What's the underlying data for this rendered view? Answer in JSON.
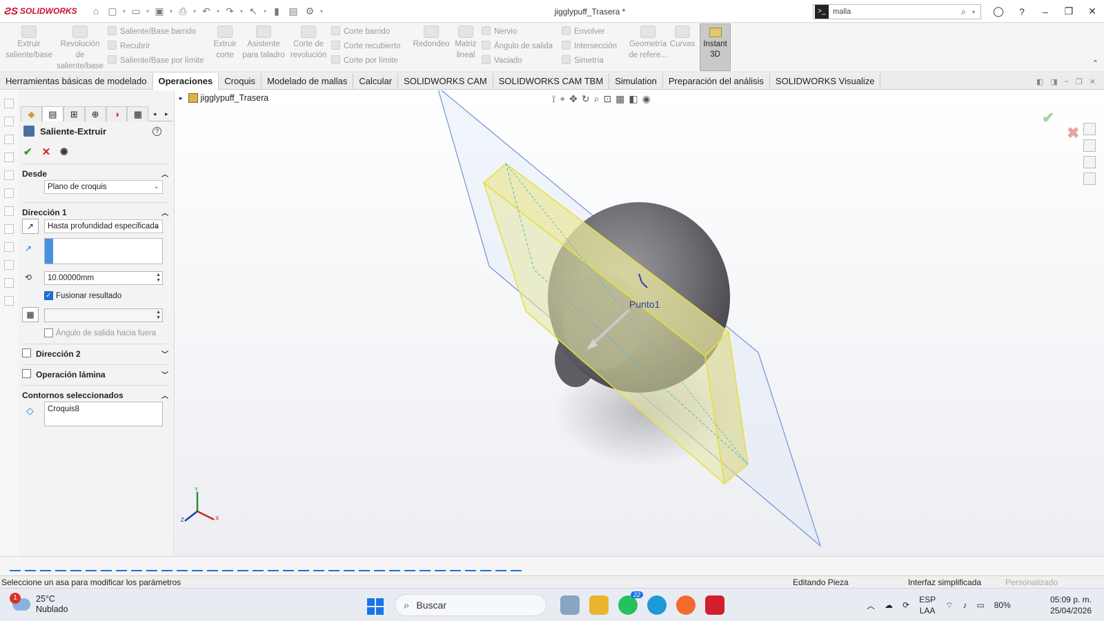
{
  "app": {
    "brand": "SOLIDWORKS",
    "doc_title": "jigglypuff_Trasera *"
  },
  "search": {
    "value": "malla"
  },
  "ribbon": {
    "big_buttons": [
      {
        "id": "extruir",
        "lines": [
          "Extruir",
          "saliente/base"
        ]
      },
      {
        "id": "revolucion",
        "lines": [
          "Revolución",
          "de",
          "saliente/base"
        ]
      },
      {
        "id": "extruir-corte",
        "lines": [
          "Extruir",
          "corte"
        ]
      },
      {
        "id": "asistente",
        "lines": [
          "Asistente",
          "para taladro"
        ]
      },
      {
        "id": "corte-revolucion",
        "lines": [
          "Corte de",
          "revolución"
        ]
      },
      {
        "id": "redondeo",
        "lines": [
          "Redondeo"
        ]
      },
      {
        "id": "matriz",
        "lines": [
          "Matriz",
          "lineal"
        ]
      },
      {
        "id": "geometria",
        "lines": [
          "Geometría",
          "de refere..."
        ]
      },
      {
        "id": "curvas",
        "lines": [
          "Curvas"
        ]
      }
    ],
    "small_buttons": [
      "Saliente/Base barrido",
      "Recubrir",
      "Saliente/Base por límite",
      "Corte barrido",
      "Corte recubierto",
      "Corte por límite",
      "Nervio",
      "Ángulo de salida",
      "Vaciado",
      "Envolver",
      "Intersección",
      "Simetría"
    ],
    "instant3d": [
      "Instant",
      "3D"
    ]
  },
  "tabs": [
    "Herramientas básicas de modelado",
    "Operaciones",
    "Croquis",
    "Modelado de mallas",
    "Calcular",
    "SOLIDWORKS CAM",
    "SOLIDWORKS CAM TBM",
    "Simulation",
    "Preparación del análisis",
    "SOLIDWORKS Visualize"
  ],
  "active_tab": "Operaciones",
  "property_manager": {
    "title": "Saliente-Extruir",
    "desde": {
      "label": "Desde",
      "value": "Plano de croquis"
    },
    "direccion1": {
      "label": "Dirección 1",
      "type": "Hasta profundidad especificada",
      "depth": "10.00000mm",
      "merge_label": "Fusionar resultado",
      "merge_checked": true,
      "draft_label": "Ángulo de salida hacia fuera"
    },
    "direccion2": {
      "label": "Dirección 2"
    },
    "lamina": {
      "label": "Operación lámina"
    },
    "contornos": {
      "label": "Contornos seleccionados",
      "value": "Croquis8"
    }
  },
  "tree": {
    "root": "jigglypuff_Trasera"
  },
  "viewport": {
    "point_label": "Punto1",
    "triad": {
      "y": "Y",
      "x": "X",
      "z": "Z"
    }
  },
  "statusbar": {
    "message": "Seleccione un asa para modificar los parámetros",
    "editing": "Editando Pieza",
    "mode": "Interfaz simplificada",
    "custom": "Personalizado"
  },
  "taskbar": {
    "weather_badge": "1",
    "temp": "25°C",
    "condition": "Nublado",
    "search_label": "Buscar",
    "whatsapp_badge": "22",
    "lang1": "ESP",
    "lang2": "LAA",
    "battery": "80%",
    "time": "05:09 p. m.",
    "date": "25/04/2026"
  },
  "colors": {
    "accent": "#1f6fd1",
    "extrude_fill": "#e8e7a0",
    "extrude_edge": "#e6df3a",
    "plane": "#6f93d6"
  }
}
